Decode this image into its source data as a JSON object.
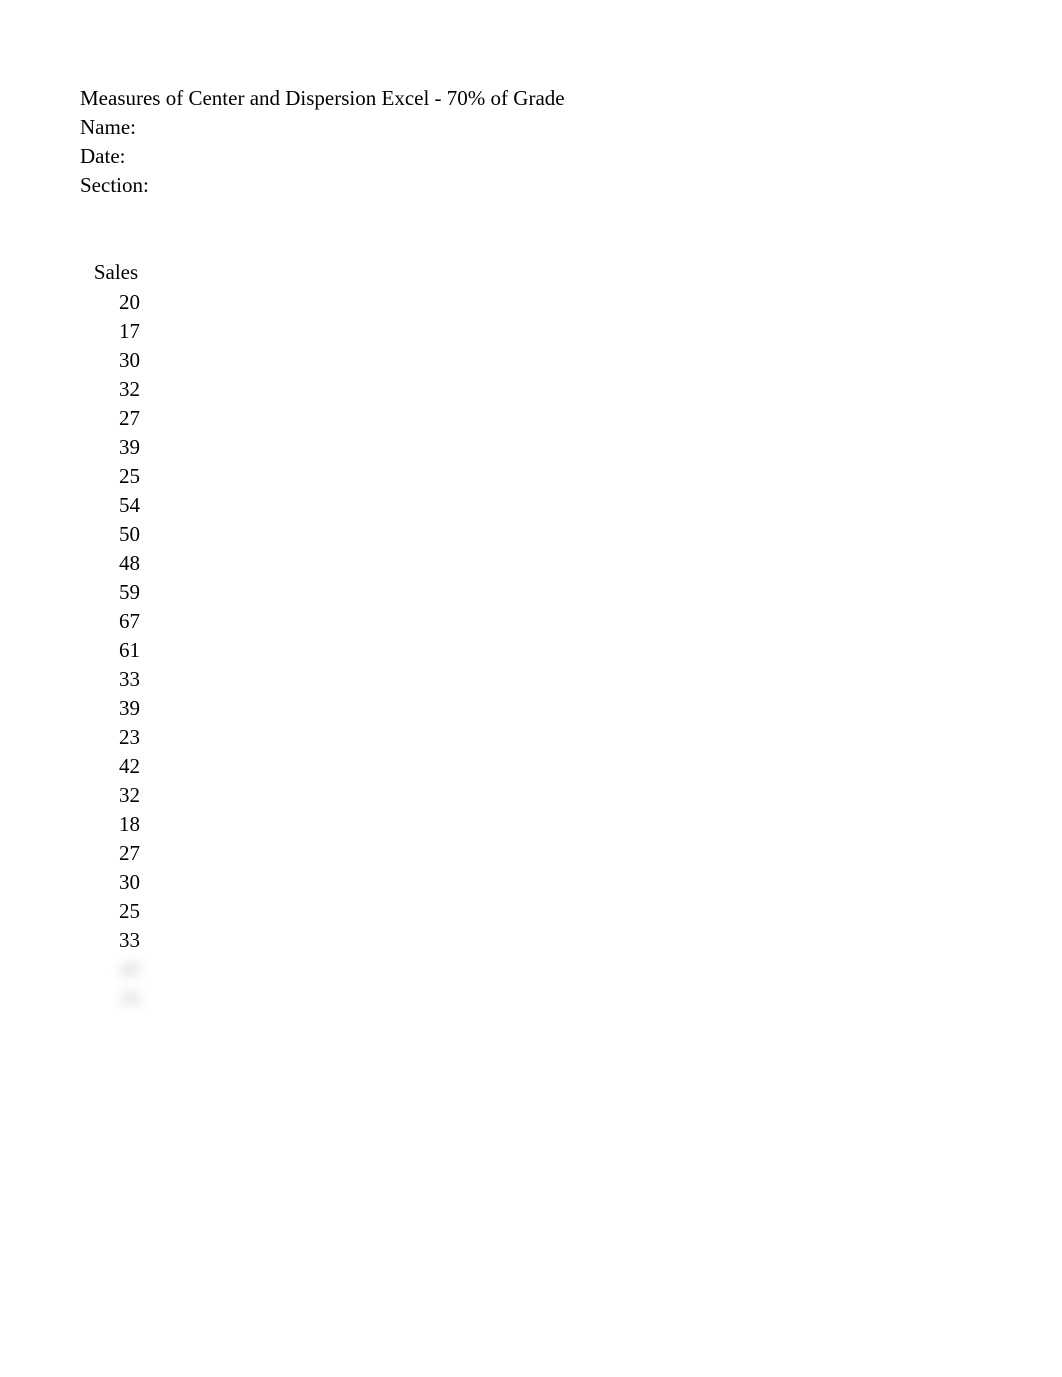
{
  "header": {
    "title": "Measures of Center and Dispersion Excel - 70% of Grade",
    "name_label": "Name:",
    "date_label": "Date:",
    "section_label": "Section:"
  },
  "table": {
    "column_header": "Sales",
    "values": [
      20,
      17,
      30,
      32,
      27,
      39,
      25,
      54,
      50,
      48,
      59,
      67,
      61,
      33,
      39,
      23,
      42,
      32,
      18,
      27,
      30,
      25,
      33
    ],
    "blurred_values": [
      40,
      36
    ]
  }
}
